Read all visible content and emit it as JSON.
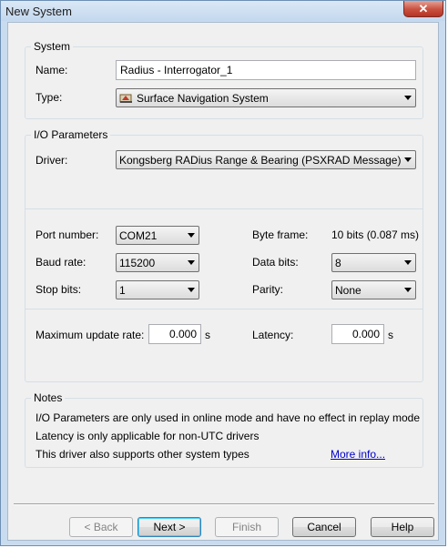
{
  "window": {
    "title": "New System",
    "close_glyph": "✕"
  },
  "system": {
    "legend": "System",
    "name_label": "Name:",
    "name_value": "Radius - Interrogator_1",
    "type_label": "Type:",
    "type_value": "Surface Navigation System",
    "type_icon": "surface-navigation-icon"
  },
  "io": {
    "legend": "I/O Parameters",
    "driver_label": "Driver:",
    "driver_value": "Kongsberg RADius Range & Bearing (PSXRAD Message)",
    "port_label": "Port number:",
    "port_value": "COM21",
    "baud_label": "Baud rate:",
    "baud_value": "115200",
    "stop_label": "Stop bits:",
    "stop_value": "1",
    "byteframe_label": "Byte frame:",
    "byteframe_value": "10 bits (0.087 ms)",
    "databits_label": "Data bits:",
    "databits_value": "8",
    "parity_label": "Parity:",
    "parity_value": "None",
    "maxrate_label": "Maximum update rate:",
    "maxrate_value": "0.000",
    "maxrate_unit": "s",
    "latency_label": "Latency:",
    "latency_value": "0.000",
    "latency_unit": "s"
  },
  "notes": {
    "legend": "Notes",
    "line1": "I/O Parameters are only used in online mode and have no effect in replay mode",
    "line2": "Latency is only applicable for non-UTC drivers",
    "line3": "This driver also supports other system types",
    "more_link": "More info..."
  },
  "buttons": {
    "back": "< Back",
    "next": "Next >",
    "finish": "Finish",
    "cancel": "Cancel",
    "help": "Help"
  }
}
